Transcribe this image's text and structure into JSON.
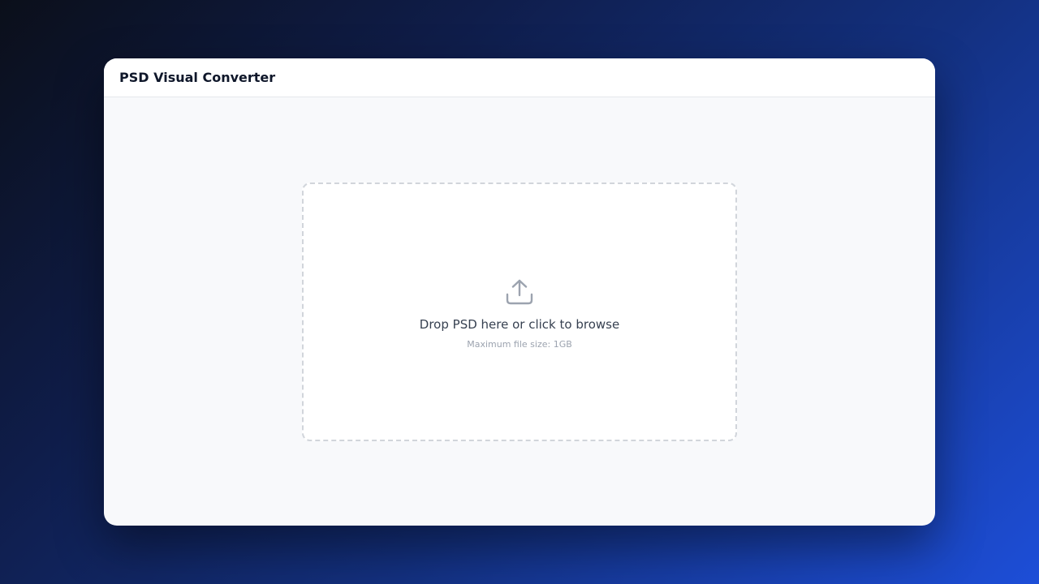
{
  "window": {
    "title": "PSD Visual Converter"
  },
  "dropzone": {
    "icon": "upload-icon",
    "prompt": "Drop PSD here or click to browse",
    "hint": "Maximum file size: 1GB"
  },
  "colors": {
    "text_primary": "#0f172a",
    "text_secondary": "#374151",
    "text_muted": "#9ca3af",
    "icon": "#9ca3af",
    "border_dashed": "#d1d5db"
  }
}
